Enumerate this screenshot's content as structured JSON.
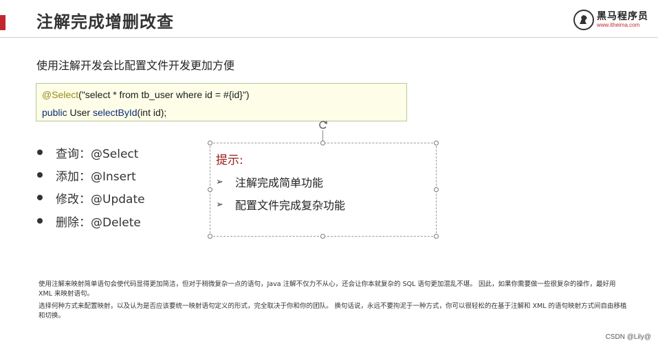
{
  "slide": {
    "title": "注解完成增删改查",
    "logo": {
      "name": "黑马程序员",
      "url": "www.itheima.com"
    },
    "subtitle": "使用注解开发会比配置文件开发更加方便",
    "code": {
      "line1": {
        "annotation": "@Select",
        "arg": "(\"select * from tb_user where id = #{id}\")"
      },
      "line2": {
        "kw": "public",
        "type": " User ",
        "method": "selectById",
        "params": "(int id);"
      }
    },
    "bullets": [
      "查询：@Select",
      "添加：@Insert",
      "修改：@Update",
      "删除：@Delete"
    ],
    "hint": {
      "title": "提示:",
      "items": [
        "注解完成简单功能",
        "配置文件完成复杂功能"
      ],
      "arrow_glyph": "➢"
    },
    "notes": [
      "使用注解来映射简单语句会使代码显得更加简洁，但对于稍微复杂一点的语句，Java 注解不仅力不从心，还会让你本就复杂的 SQL 语句更加混乱不堪。 因此，如果你需要做一些很复杂的操作，最好用 XML 来映射语句。",
      "选择何种方式来配置映射，以及认为是否应该要统一映射语句定义的形式，完全取决于你和你的团队。 换句话说，永远不要拘泥于一种方式，你可以很轻松的在基于注解和 XML 的语句映射方式间自由移植和切换。"
    ],
    "watermark": "CSDN @Lily@"
  },
  "colors": {
    "accent": "#c0282d",
    "hint_title": "#9b1c1c",
    "code_bg": "#fdfde8",
    "annotation": "#9a8a14",
    "keyword": "#0b2e7a"
  },
  "icons": {
    "logo": "horse-logo-icon",
    "rotate": "rotate-handle-icon",
    "bullet": "bullet-dot-icon"
  }
}
